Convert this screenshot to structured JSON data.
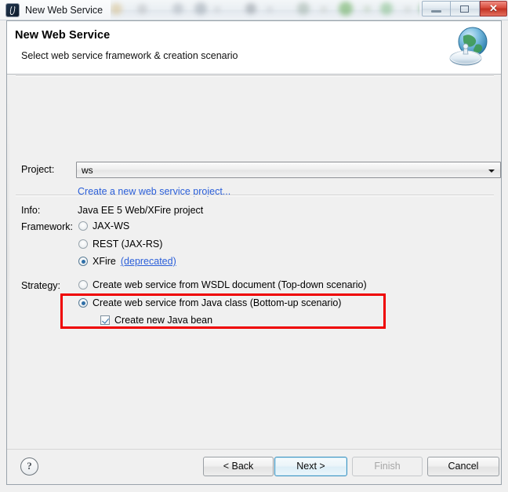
{
  "window": {
    "title": "New Web Service",
    "app_icon": "eclipse-wizard-icon",
    "controls": {
      "minimize": "minimize-icon",
      "maximize": "maximize-icon",
      "close": "✕"
    }
  },
  "banner": {
    "title": "New Web Service",
    "subtitle": "Select web service framework & creation scenario",
    "icon": "globe-satellite-dish-icon"
  },
  "form": {
    "project_label": "Project:",
    "project_value": "ws",
    "create_project_link": "Create a new web service project...",
    "info_label": "Info:",
    "info_value": "Java EE 5 Web/XFire project",
    "framework_label": "Framework:",
    "framework_options": [
      {
        "label": "JAX-WS",
        "selected": false
      },
      {
        "label": "REST (JAX-RS)",
        "selected": false
      },
      {
        "label": "XFire",
        "selected": true,
        "link": "(deprecated)"
      }
    ],
    "strategy_label": "Strategy:",
    "strategy_options": [
      {
        "label": "Create web service from WSDL document (Top-down scenario)",
        "selected": false
      },
      {
        "label": "Create web service from Java class (Bottom-up scenario)",
        "selected": true
      }
    ],
    "create_bean_checkbox": {
      "label": "Create new Java bean",
      "checked": true
    }
  },
  "annotation": {
    "color": "#ef0000"
  },
  "footer": {
    "help": "?",
    "buttons": [
      {
        "label": "< Back",
        "state": "normal"
      },
      {
        "label": "Next >",
        "state": "focused"
      },
      {
        "label": "Finish",
        "state": "disabled"
      },
      {
        "label": "Cancel",
        "state": "normal"
      }
    ]
  },
  "colors": {
    "link": "#2b5fd9",
    "accent": "#2f6fa8",
    "annotation": "#ef0000",
    "close_button": "#c13122"
  }
}
